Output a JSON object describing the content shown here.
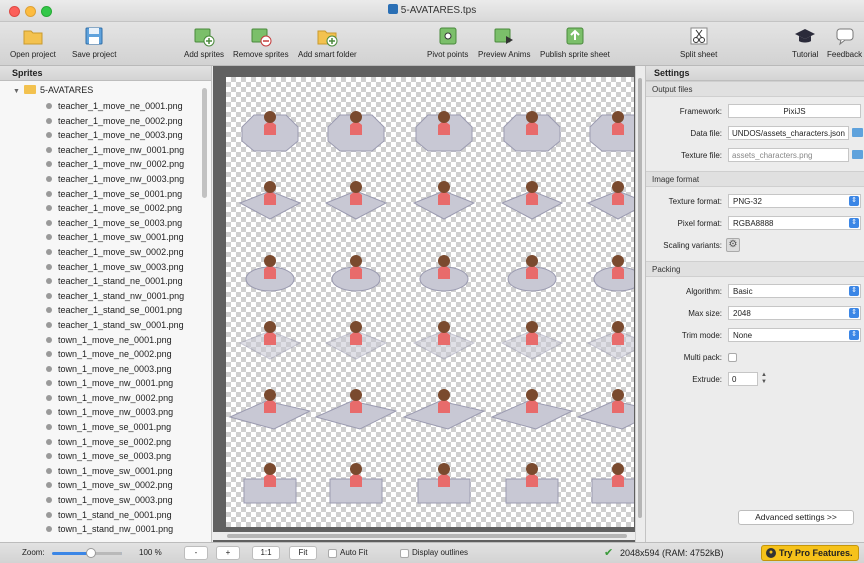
{
  "window": {
    "title": "5-AVATARES.tps"
  },
  "toolbar": {
    "open_project": "Open project",
    "save_project": "Save project",
    "add_sprites": "Add sprites",
    "remove_sprites": "Remove sprites",
    "add_smart_folder": "Add smart folder",
    "pivot_points": "Pivot points",
    "preview_anims": "Preview Anims",
    "publish_sprite_sheet": "Publish sprite sheet",
    "split_sheet": "Split sheet",
    "tutorial": "Tutorial",
    "feedback": "Feedback"
  },
  "sprites": {
    "heading": "Sprites",
    "root_folder": "5-AVATARES",
    "items": [
      "teacher_1_move_ne_0001.png",
      "teacher_1_move_ne_0002.png",
      "teacher_1_move_ne_0003.png",
      "teacher_1_move_nw_0001.png",
      "teacher_1_move_nw_0002.png",
      "teacher_1_move_nw_0003.png",
      "teacher_1_move_se_0001.png",
      "teacher_1_move_se_0002.png",
      "teacher_1_move_se_0003.png",
      "teacher_1_move_sw_0001.png",
      "teacher_1_move_sw_0002.png",
      "teacher_1_move_sw_0003.png",
      "teacher_1_stand_ne_0001.png",
      "teacher_1_stand_nw_0001.png",
      "teacher_1_stand_se_0001.png",
      "teacher_1_stand_sw_0001.png",
      "town_1_move_ne_0001.png",
      "town_1_move_ne_0002.png",
      "town_1_move_ne_0003.png",
      "town_1_move_nw_0001.png",
      "town_1_move_nw_0002.png",
      "town_1_move_nw_0003.png",
      "town_1_move_se_0001.png",
      "town_1_move_se_0002.png",
      "town_1_move_se_0003.png",
      "town_1_move_sw_0001.png",
      "town_1_move_sw_0002.png",
      "town_1_move_sw_0003.png",
      "town_1_stand_ne_0001.png",
      "town_1_stand_nw_0001.png"
    ]
  },
  "settings": {
    "heading": "Settings",
    "output_files": {
      "heading": "Output files",
      "framework_label": "Framework:",
      "framework_value": "PixiJS",
      "data_file_label": "Data file:",
      "data_file_value": "UNDOS/assets_characters.json",
      "texture_file_label": "Texture file:",
      "texture_file_value": "assets_characters.png"
    },
    "image_format": {
      "heading": "Image format",
      "texture_format_label": "Texture format:",
      "texture_format_value": "PNG-32",
      "pixel_format_label": "Pixel format:",
      "pixel_format_value": "RGBA8888",
      "scaling_variants_label": "Scaling variants:"
    },
    "packing": {
      "heading": "Packing",
      "algorithm_label": "Algorithm:",
      "algorithm_value": "Basic",
      "max_size_label": "Max size:",
      "max_size_value": "2048",
      "trim_mode_label": "Trim mode:",
      "trim_mode_value": "None",
      "multi_pack_label": "Multi pack:",
      "extrude_label": "Extrude:",
      "extrude_value": "0"
    },
    "advanced_button": "Advanced settings >>"
  },
  "bottombar": {
    "zoom_label": "Zoom:",
    "zoom_value": "100 %",
    "zoom_fraction": 0.55,
    "minus": "-",
    "plus": "+",
    "one_to_one": "1:1",
    "fit": "Fit",
    "auto_fit": "Auto Fit",
    "display_outlines": "Display outlines",
    "status": "2048x594 (RAM: 4752kB)",
    "pro_button": "Try Pro Features."
  },
  "canvas": {
    "rows": [
      {
        "type": "octagon-table",
        "count": 5
      },
      {
        "type": "desk-corner",
        "count": 5
      },
      {
        "type": "round-table",
        "count": 5
      },
      {
        "type": "ghost-desk",
        "count": 5
      },
      {
        "type": "long-desk",
        "count": 5
      },
      {
        "type": "box-desk",
        "count": 5
      }
    ],
    "colors": {
      "skin": "#7a4a2e",
      "shirt": "#e86b6b",
      "furniture": "#c8c8d4",
      "furniture_dark": "#9b9bb0"
    }
  }
}
